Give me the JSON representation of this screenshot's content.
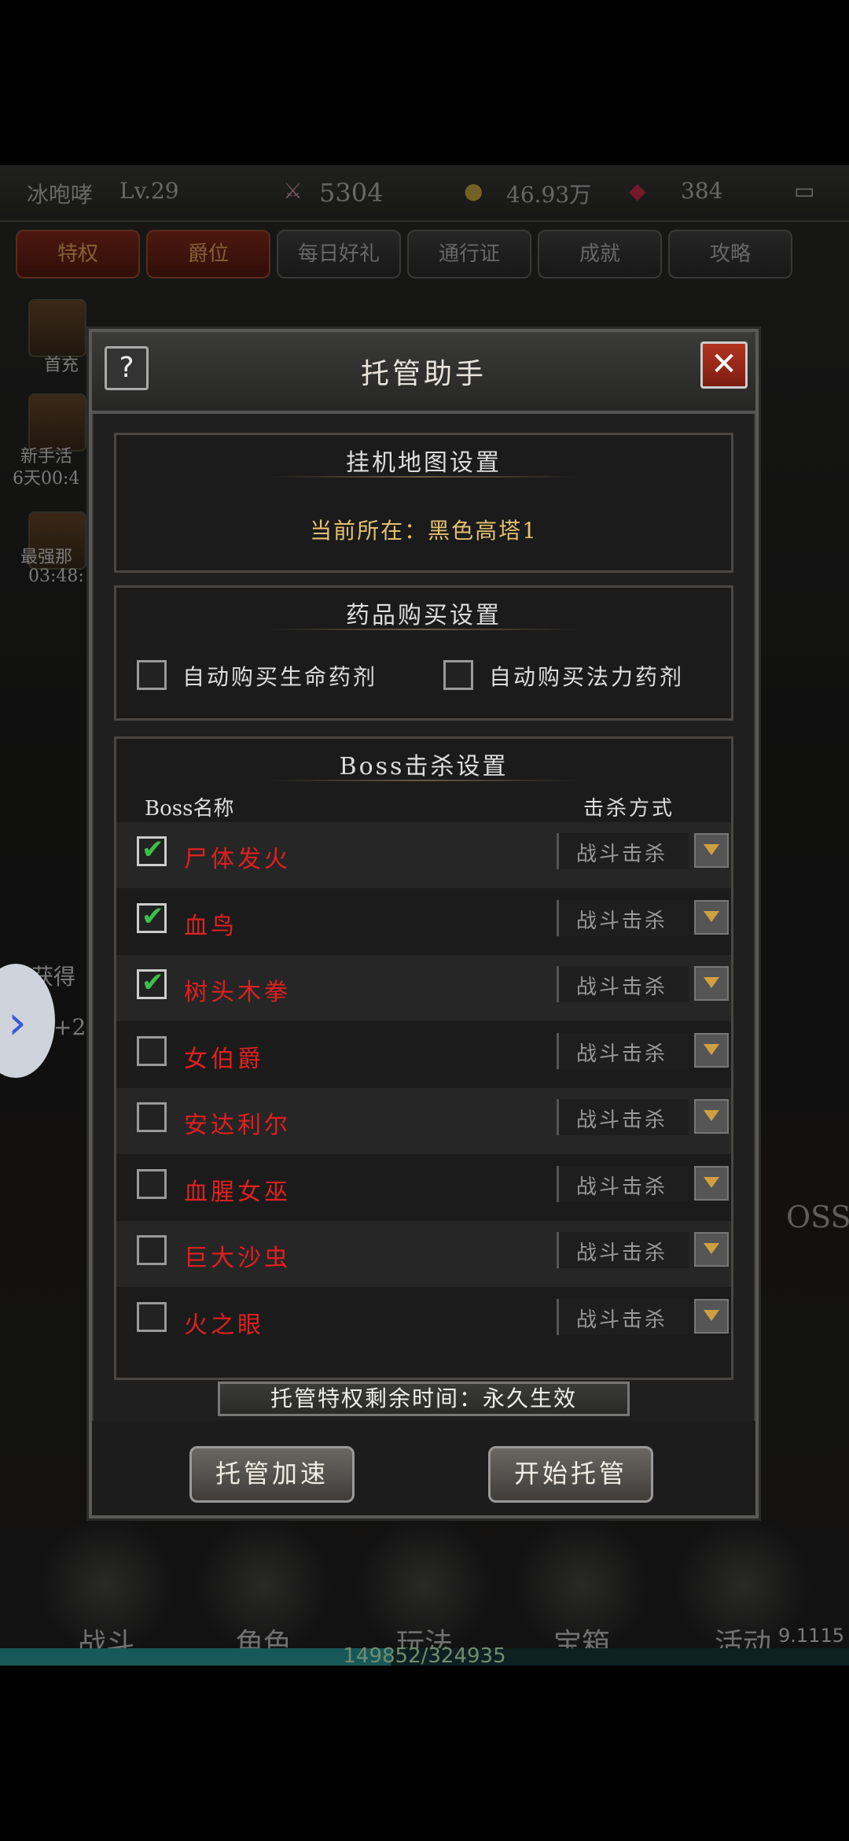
{
  "background": {
    "player_name": "冰咆哮",
    "level": "Lv.29",
    "power": "5304",
    "gold": "46.93万",
    "gems": "384",
    "menu": [
      "特权",
      "爵位",
      "每日好礼",
      "通行证",
      "成就",
      "攻略"
    ],
    "side_labels": [
      "首充",
      "新手活",
      "6天00:4",
      "最强那",
      "03:48:",
      "获得",
      "币+2"
    ],
    "bottom_nav": [
      "战斗",
      "角色",
      "玩法",
      "宝箱",
      "活动"
    ],
    "xp_text": "149852/324935",
    "version": "9.1115",
    "boss_label": "OSS"
  },
  "modal": {
    "title": "托管助手",
    "help_label": "?",
    "close_label": "✕",
    "map_section": {
      "title": "挂机地图设置",
      "location": "当前所在：黑色高塔1"
    },
    "potion_section": {
      "title": "药品购买设置",
      "options": [
        {
          "label": "自动购买生命药剂",
          "checked": false
        },
        {
          "label": "自动购买法力药剂",
          "checked": false
        }
      ]
    },
    "boss_section": {
      "title": "Boss击杀设置",
      "col_name": "Boss名称",
      "col_method": "击杀方式",
      "rows": [
        {
          "name": "尸体发火",
          "checked": true,
          "method": "战斗击杀"
        },
        {
          "name": "血鸟",
          "checked": true,
          "method": "战斗击杀"
        },
        {
          "name": "树头木拳",
          "checked": true,
          "method": "战斗击杀"
        },
        {
          "name": "女伯爵",
          "checked": false,
          "method": "战斗击杀"
        },
        {
          "name": "安达利尔",
          "checked": false,
          "method": "战斗击杀"
        },
        {
          "name": "血腥女巫",
          "checked": false,
          "method": "战斗击杀"
        },
        {
          "name": "巨大沙虫",
          "checked": false,
          "method": "战斗击杀"
        },
        {
          "name": "火之眼",
          "checked": false,
          "method": "战斗击杀"
        }
      ]
    },
    "timer": "托管特权剩余时间：永久生效",
    "buttons": {
      "speed": "托管加速",
      "start": "开始托管"
    }
  },
  "colors": {
    "boss_name": "#e02020",
    "location": "#e3c070",
    "check": "#3cc04a"
  }
}
